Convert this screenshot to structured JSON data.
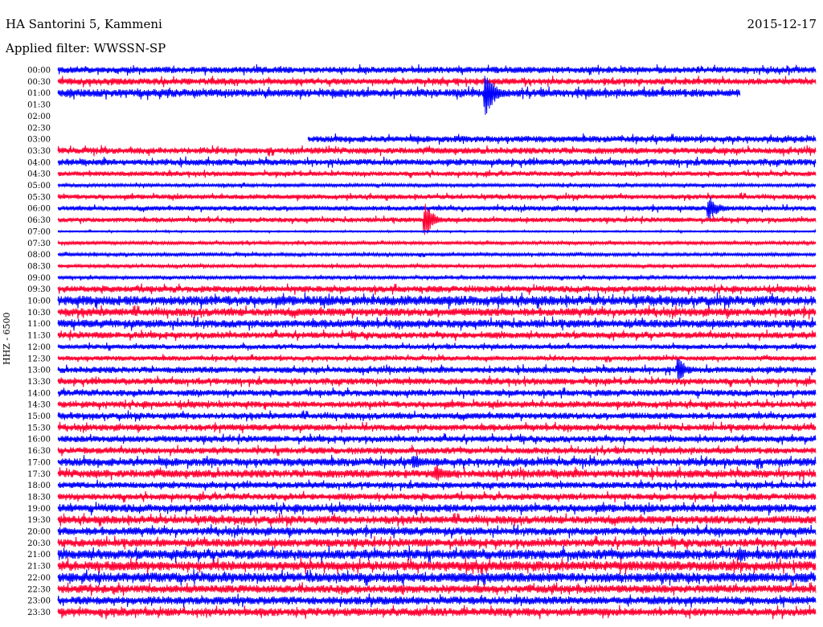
{
  "header": {
    "station": "HA Santorini 5, Kammeni",
    "date": "2015-12-17",
    "filter": "Applied filter: WWSSN-SP"
  },
  "colors": {
    "even_trace": "#0000ff",
    "odd_trace": "#ff0033"
  },
  "chart_data": {
    "type": "line",
    "title": "HA Santorini 5, Kammeni",
    "ylabel": "HHZ - 6500",
    "xlabel": "",
    "rows": [
      {
        "label": "00:00",
        "amp": 4
      },
      {
        "label": "00:30",
        "amp": 4
      },
      {
        "label": "01:00",
        "amp": 5,
        "end": 0.9
      },
      {
        "label": "01:30",
        "amp": 0
      },
      {
        "label": "02:00",
        "amp": 0
      },
      {
        "label": "02:30",
        "amp": 0
      },
      {
        "label": "03:00",
        "amp": 4,
        "start": 0.33
      },
      {
        "label": "03:30",
        "amp": 4
      },
      {
        "label": "04:00",
        "amp": 4
      },
      {
        "label": "04:30",
        "amp": 3
      },
      {
        "label": "05:00",
        "amp": 2
      },
      {
        "label": "05:30",
        "amp": 3
      },
      {
        "label": "06:00",
        "amp": 3
      },
      {
        "label": "06:30",
        "amp": 3
      },
      {
        "label": "07:00",
        "amp": 1
      },
      {
        "label": "07:30",
        "amp": 2
      },
      {
        "label": "08:00",
        "amp": 2
      },
      {
        "label": "08:30",
        "amp": 2
      },
      {
        "label": "09:00",
        "amp": 2
      },
      {
        "label": "09:30",
        "amp": 4
      },
      {
        "label": "10:00",
        "amp": 6
      },
      {
        "label": "10:30",
        "amp": 5
      },
      {
        "label": "11:00",
        "amp": 5
      },
      {
        "label": "11:30",
        "amp": 4
      },
      {
        "label": "12:00",
        "amp": 3
      },
      {
        "label": "12:30",
        "amp": 3
      },
      {
        "label": "13:00",
        "amp": 4
      },
      {
        "label": "13:30",
        "amp": 4
      },
      {
        "label": "14:00",
        "amp": 4
      },
      {
        "label": "14:30",
        "amp": 4
      },
      {
        "label": "15:00",
        "amp": 4
      },
      {
        "label": "15:30",
        "amp": 4
      },
      {
        "label": "16:00",
        "amp": 4
      },
      {
        "label": "16:30",
        "amp": 4
      },
      {
        "label": "17:00",
        "amp": 5
      },
      {
        "label": "17:30",
        "amp": 5
      },
      {
        "label": "18:00",
        "amp": 4
      },
      {
        "label": "18:30",
        "amp": 4
      },
      {
        "label": "19:00",
        "amp": 5
      },
      {
        "label": "19:30",
        "amp": 5
      },
      {
        "label": "20:00",
        "amp": 5
      },
      {
        "label": "20:30",
        "amp": 5
      },
      {
        "label": "21:00",
        "amp": 6
      },
      {
        "label": "21:30",
        "amp": 6
      },
      {
        "label": "22:00",
        "amp": 6
      },
      {
        "label": "22:30",
        "amp": 5
      },
      {
        "label": "23:00",
        "amp": 5
      },
      {
        "label": "23:30",
        "amp": 5
      }
    ],
    "events": [
      {
        "row": 2,
        "at": 0.565,
        "amp": 28
      },
      {
        "row": 13,
        "at": 0.485,
        "amp": 20
      },
      {
        "row": 12,
        "at": 0.86,
        "amp": 16
      },
      {
        "row": 26,
        "at": 0.82,
        "amp": 14
      },
      {
        "row": 34,
        "at": 0.47,
        "amp": 10
      },
      {
        "row": 35,
        "at": 0.5,
        "amp": 12
      },
      {
        "row": 42,
        "at": 0.9,
        "amp": 11
      }
    ]
  }
}
